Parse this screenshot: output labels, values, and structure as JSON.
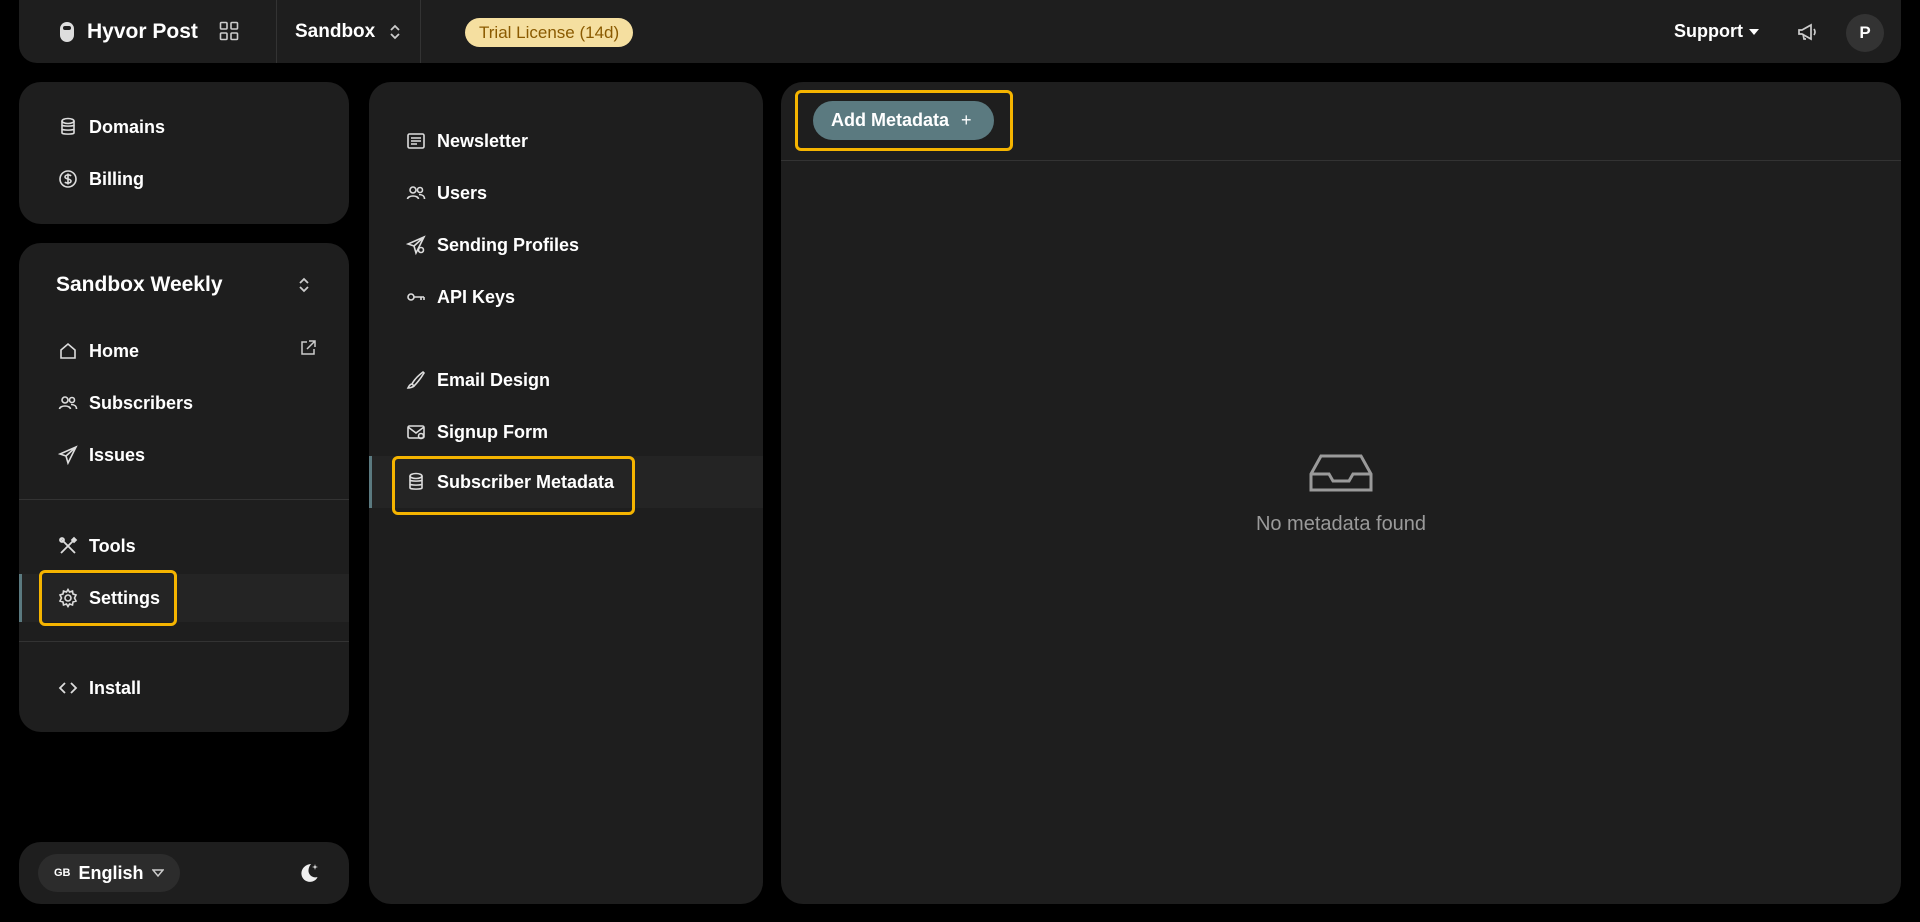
{
  "topbar": {
    "brand": "Hyvor Post",
    "project": "Sandbox",
    "trial_badge": "Trial License (14d)",
    "support": "Support",
    "avatar_initial": "P"
  },
  "account_nav": {
    "items": [
      {
        "label": "Domains",
        "icon": "database-icon"
      },
      {
        "label": "Billing",
        "icon": "dollar-icon"
      }
    ]
  },
  "newsletter_nav": {
    "title": "Sandbox Weekly",
    "items": [
      {
        "label": "Home",
        "icon": "home-icon"
      },
      {
        "label": "Subscribers",
        "icon": "users-icon"
      },
      {
        "label": "Issues",
        "icon": "send-icon"
      },
      {
        "label": "Tools",
        "icon": "tools-icon"
      },
      {
        "label": "Settings",
        "icon": "gear-icon",
        "active": true
      },
      {
        "label": "Install",
        "icon": "code-icon"
      }
    ]
  },
  "footer": {
    "language": "English",
    "flag_code": "GB"
  },
  "settings_nav": {
    "items": [
      {
        "label": "Newsletter",
        "icon": "newsletter-icon"
      },
      {
        "label": "Users",
        "icon": "users-icon"
      },
      {
        "label": "Sending Profiles",
        "icon": "send-profile-icon"
      },
      {
        "label": "API Keys",
        "icon": "key-icon"
      },
      {
        "label": "Email Design",
        "icon": "brush-icon"
      },
      {
        "label": "Signup Form",
        "icon": "mail-form-icon"
      },
      {
        "label": "Subscriber Metadata",
        "icon": "database-icon",
        "active": true
      }
    ]
  },
  "content": {
    "add_button": "Add Metadata",
    "add_symbol": "+",
    "empty_message": "No metadata found"
  },
  "colors": {
    "accent": "#5b7a80",
    "highlight": "#f5b400",
    "panel": "#1e1e1e",
    "badge_bg": "#f5dfa0"
  }
}
